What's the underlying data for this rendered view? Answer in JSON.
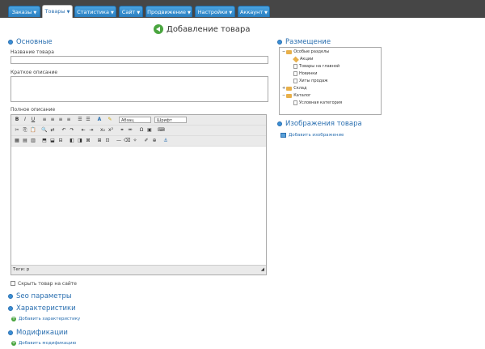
{
  "nav": {
    "tabs": [
      {
        "label": "Заказы"
      },
      {
        "label": "Товары"
      },
      {
        "label": "Статистика"
      },
      {
        "label": "Сайт"
      },
      {
        "label": "Продвижение"
      },
      {
        "label": "Настройки"
      },
      {
        "label": "Аккаунт"
      }
    ],
    "active_tab": "Товары"
  },
  "page": {
    "title": "Добавление товара"
  },
  "main": {
    "section_title": "Основные",
    "name_label": "Название товара",
    "short_desc_label": "Краткое описание",
    "full_desc_label": "Полное описание",
    "editor": {
      "format_select": "Абзац",
      "font_select": "Шрифт",
      "status_path": "Теги: p"
    },
    "hide_product_label": "Скрыть товар на сайте"
  },
  "seo": {
    "title": "Seo параметры"
  },
  "characteristics": {
    "title": "Характеристики",
    "add_label": "Добавить характеристику"
  },
  "modifications": {
    "title": "Модификации",
    "add_label": "Добавить модификацию"
  },
  "placement": {
    "title": "Размещение",
    "tree": [
      {
        "label": "Особые разделы"
      },
      {
        "label": "Акции"
      },
      {
        "label": "Товары на главной"
      },
      {
        "label": "Новинки"
      },
      {
        "label": "Хиты продаж"
      },
      {
        "label": "Склад"
      },
      {
        "label": "Каталог"
      },
      {
        "label": "Условная категория"
      }
    ]
  },
  "images": {
    "title": "Изображения товара",
    "add_label": "Добавить изображение"
  },
  "colors": {
    "accent": "#2a6fb0",
    "tab_blue": "#2a7fc0",
    "topbar": "#464646",
    "add_green": "#4aa53f"
  }
}
